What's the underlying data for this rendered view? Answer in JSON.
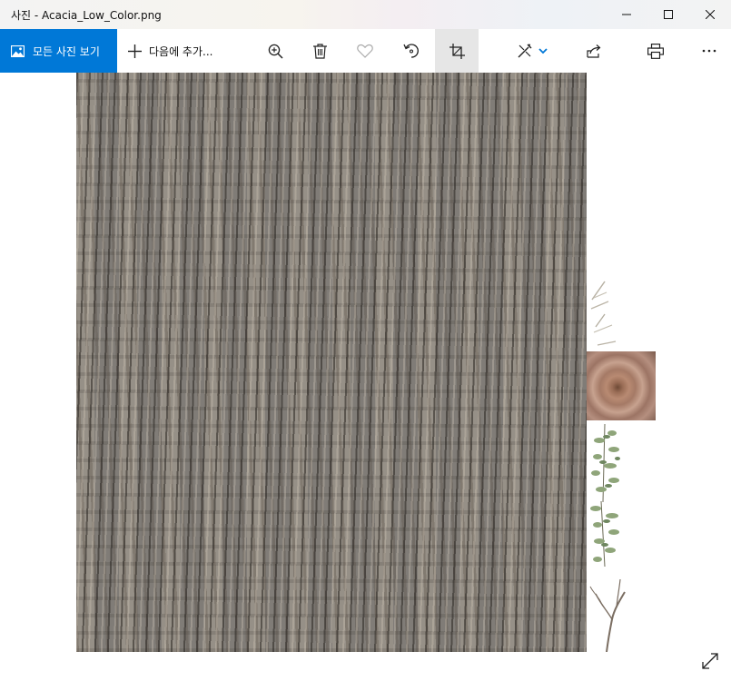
{
  "window": {
    "title": "사진 - Acacia_Low_Color.png",
    "controls": [
      "minimize-icon",
      "maximize-icon",
      "close-icon"
    ]
  },
  "toolbar": {
    "all_photos_label": "모든 사진 보기",
    "add_to_label": "다음에 추가...",
    "icons": [
      "zoom-in-icon",
      "delete-icon",
      "favorite-heart-icon",
      "rotate-icon",
      "crop-icon",
      "edit-icon",
      "chevron-down-icon",
      "share-icon",
      "print-icon",
      "more-icon"
    ],
    "accent_color": "#0078d7"
  },
  "viewer": {
    "image_name": "Acacia_Low_Color.png",
    "expand_icon": "fullscreen-expand-icon"
  }
}
